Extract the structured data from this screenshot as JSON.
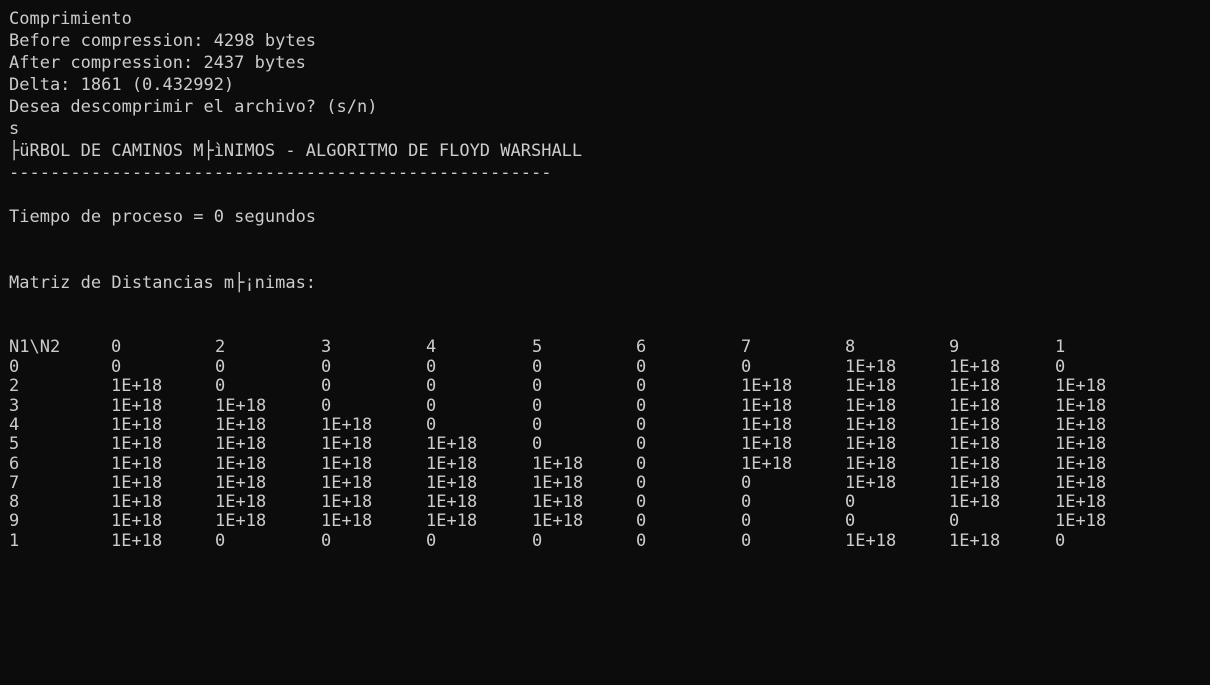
{
  "terminal": {
    "lines": [
      "Comprimiento",
      "Before compression: 4298 bytes",
      "After compression: 2437 bytes",
      "Delta: 1861 (0.432992)",
      "Desea descomprimir el archivo? (s/n)",
      "s",
      "├üRBOL DE CAMINOS M├ìNIMOS - ALGORITMO DE FLOYD WARSHALL",
      "-----------------------------------------------------",
      "Tiempo de proceso = 0 segundos",
      "Matriz de Distancias m├¡nimas:"
    ],
    "matrix": {
      "corner": "N1\\N2",
      "headers": [
        "0",
        "2",
        "3",
        "4",
        "5",
        "6",
        "7",
        "8",
        "9",
        "1"
      ],
      "rows": [
        {
          "label": "0",
          "cells": [
            "0",
            "0",
            "0",
            "0",
            "0",
            "0",
            "0",
            "1E+18",
            "1E+18",
            "0"
          ]
        },
        {
          "label": "2",
          "cells": [
            "1E+18",
            "0",
            "0",
            "0",
            "0",
            "0",
            "1E+18",
            "1E+18",
            "1E+18",
            "1E+18"
          ]
        },
        {
          "label": "3",
          "cells": [
            "1E+18",
            "1E+18",
            "0",
            "0",
            "0",
            "0",
            "1E+18",
            "1E+18",
            "1E+18",
            "1E+18"
          ]
        },
        {
          "label": "4",
          "cells": [
            "1E+18",
            "1E+18",
            "1E+18",
            "0",
            "0",
            "0",
            "1E+18",
            "1E+18",
            "1E+18",
            "1E+18"
          ]
        },
        {
          "label": "5",
          "cells": [
            "1E+18",
            "1E+18",
            "1E+18",
            "1E+18",
            "0",
            "0",
            "1E+18",
            "1E+18",
            "1E+18",
            "1E+18"
          ]
        },
        {
          "label": "6",
          "cells": [
            "1E+18",
            "1E+18",
            "1E+18",
            "1E+18",
            "1E+18",
            "0",
            "1E+18",
            "1E+18",
            "1E+18",
            "1E+18"
          ]
        },
        {
          "label": "7",
          "cells": [
            "1E+18",
            "1E+18",
            "1E+18",
            "1E+18",
            "1E+18",
            "0",
            "0",
            "1E+18",
            "1E+18",
            "1E+18"
          ]
        },
        {
          "label": "8",
          "cells": [
            "1E+18",
            "1E+18",
            "1E+18",
            "1E+18",
            "1E+18",
            "0",
            "0",
            "0",
            "1E+18",
            "1E+18"
          ]
        },
        {
          "label": "9",
          "cells": [
            "1E+18",
            "1E+18",
            "1E+18",
            "1E+18",
            "1E+18",
            "0",
            "0",
            "0",
            "0",
            "1E+18"
          ]
        },
        {
          "label": "1",
          "cells": [
            "1E+18",
            "0",
            "0",
            "0",
            "0",
            "0",
            "0",
            "1E+18",
            "1E+18",
            "0"
          ]
        }
      ]
    }
  },
  "colors": {
    "background": "#0c0c0c",
    "foreground": "#cccccc"
  }
}
